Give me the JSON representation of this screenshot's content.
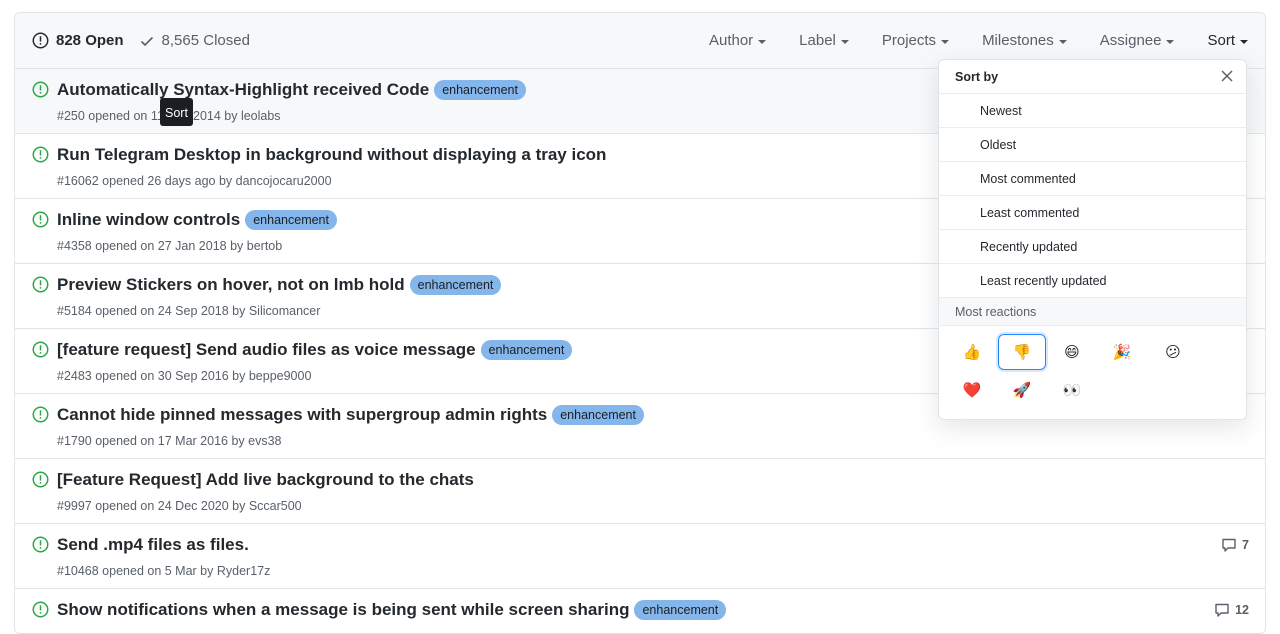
{
  "header": {
    "open_count": "828 Open",
    "closed_count": "8,565 Closed",
    "filters": [
      "Author",
      "Label",
      "Projects",
      "Milestones",
      "Assignee",
      "Sort"
    ]
  },
  "tooltip": {
    "text": "Sort"
  },
  "issues": [
    {
      "title": "Automatically Syntax-Highlight received Code",
      "label": "enhancement",
      "meta": "#250 opened on 11 Dec 2014 by leolabs",
      "comments": ""
    },
    {
      "title": "Run Telegram Desktop in background without displaying a tray icon",
      "label": "",
      "meta": "#16062 opened 26 days ago by dancojocaru2000",
      "comments": ""
    },
    {
      "title": "Inline window controls",
      "label": "enhancement",
      "meta": "#4358 opened on 27 Jan 2018 by bertob",
      "comments": ""
    },
    {
      "title": "Preview Stickers on hover, not on lmb hold",
      "label": "enhancement",
      "meta": "#5184 opened on 24 Sep 2018 by Silicomancer",
      "comments": ""
    },
    {
      "title": "[feature request] Send audio files as voice message",
      "label": "enhancement",
      "meta": "#2483 opened on 30 Sep 2016 by beppe9000",
      "comments": ""
    },
    {
      "title": "Cannot hide pinned messages with supergroup admin rights",
      "label": "enhancement",
      "meta": "#1790 opened on 17 Mar 2016 by evs38",
      "comments": ""
    },
    {
      "title": "[Feature Request] Add live background to the chats",
      "label": "",
      "meta": "#9997 opened on 24 Dec 2020 by Sccar500",
      "comments": ""
    },
    {
      "title": "Send .mp4 files as files.",
      "label": "",
      "meta": "#10468 opened on 5 Mar by Ryder17z",
      "comments": "7"
    },
    {
      "title": "Show notifications when a message is being sent while screen sharing",
      "label": "enhancement",
      "meta": "",
      "comments": "12"
    }
  ],
  "sort_menu": {
    "title": "Sort by",
    "items": [
      "Newest",
      "Oldest",
      "Most commented",
      "Least commented",
      "Recently updated",
      "Least recently updated"
    ],
    "reactions_section": "Most reactions",
    "reactions": [
      "👍",
      "👎",
      "😄",
      "🎉",
      "😕",
      "❤️",
      "🚀",
      "👀"
    ],
    "selected_reaction": "👎"
  },
  "colors": {
    "open_icon": "#28a745",
    "label_enhancement": "#84b6eb",
    "selected_border": "#2188ff"
  }
}
